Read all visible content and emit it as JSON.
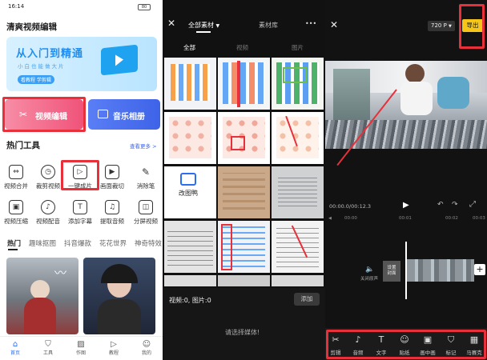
{
  "panel1": {
    "status_time": "16:14",
    "status_battery": "80",
    "app_title": "清爽视频编辑",
    "banner_title": "从入门到精通",
    "banner_subtitle": "小白也能做大片",
    "banner_tags": "看教程 学剪辑",
    "video_edit_label": "视频编辑",
    "music_album_label": "音乐相册",
    "hot_tools_title": "热门工具",
    "see_more": "查看更多 >",
    "tools_row1": [
      "视频合并",
      "裁剪视频",
      "一键成片",
      "画面裁切",
      "消除笔"
    ],
    "tools_row2": [
      "视频压缩",
      "视频配音",
      "添加字幕",
      "提取音频",
      "分屏视频"
    ],
    "category_tabs": [
      "热门",
      "趣味抠图",
      "抖音爆款",
      "花花世界",
      "神奇特效"
    ],
    "bottom_nav": [
      "首页",
      "工具",
      "作图",
      "教程",
      "我的"
    ]
  },
  "panel2": {
    "album_selector": "全部素材",
    "library_tab": "素材库",
    "more_dots": "•••",
    "filter_tabs": [
      "全部",
      "视频",
      "图片"
    ],
    "selection_count": "视频:0, 图片:0",
    "add_button": "添加",
    "empty_hint": "请选择媒体!",
    "thumb_text_gaitu": "改图鸭"
  },
  "panel3": {
    "resolution": "720 P",
    "export_button": "导出",
    "timecode": "00:00.0/00:12.3",
    "ruler_marks": [
      "00:00",
      "00:01",
      "00:02",
      "00:03"
    ],
    "mute_label": "关闭原声",
    "cover_label": "设置\n封面",
    "tools": [
      "剪辑",
      "音频",
      "文字",
      "贴纸",
      "画中画",
      "标记",
      "马赛克"
    ]
  },
  "colors": {
    "accent_red": "#e8303a",
    "video_btn_pink": "#f0537a",
    "music_btn_blue": "#3e63e8",
    "active_blue": "#2b6ef2",
    "export_yellow": "#f5c518"
  }
}
